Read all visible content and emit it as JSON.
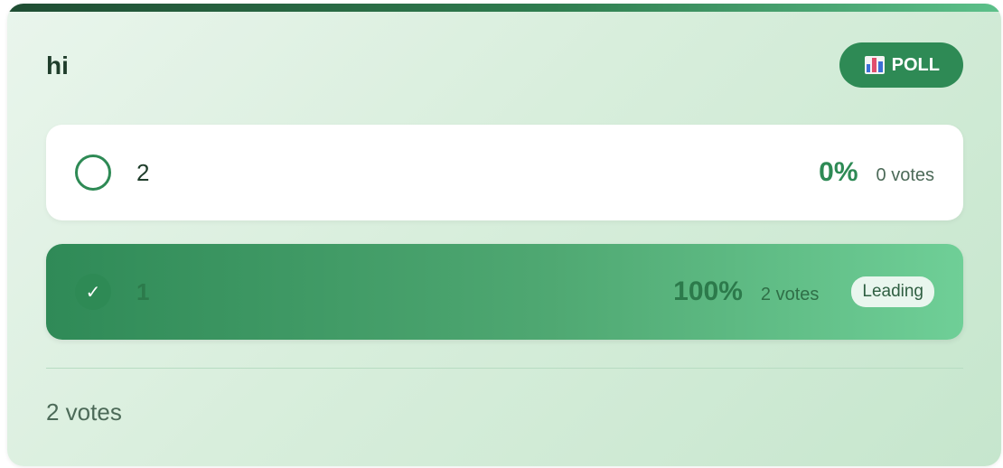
{
  "poll": {
    "question": "hi",
    "badge_label": "POLL",
    "badge_icon": "bar-chart-icon",
    "options": [
      {
        "label": "2",
        "percent": "0%",
        "votes": "0 votes",
        "selected": false,
        "leading": false
      },
      {
        "label": "1",
        "percent": "100%",
        "votes": "2 votes",
        "selected": true,
        "leading": true,
        "leading_label": "Leading",
        "check_glyph": "✓"
      }
    ],
    "total_votes": "2 votes"
  },
  "colors": {
    "accent": "#2e8a55",
    "accent_dark": "#1f4d33",
    "accent_light": "#6fcf97",
    "text_dark": "#1f3d2b",
    "text_muted": "#4c6a58"
  }
}
